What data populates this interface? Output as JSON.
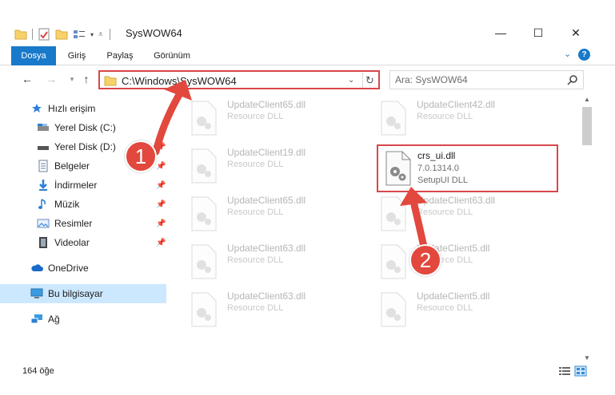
{
  "window": {
    "title": "SysWOW64",
    "minimize": "—",
    "maximize": "☐",
    "close": "✕"
  },
  "ribbon": {
    "tabs": [
      {
        "label": "Dosya",
        "active": true
      },
      {
        "label": "Giriş",
        "active": false
      },
      {
        "label": "Paylaş",
        "active": false
      },
      {
        "label": "Görünüm",
        "active": false
      }
    ]
  },
  "navbar": {
    "address": "C:\\Windows\\SysWOW64",
    "search_placeholder": "Ara: SysWOW64"
  },
  "sidebar": {
    "items": [
      {
        "label": "Hızlı erişim",
        "icon": "star-icon"
      },
      {
        "label": "Yerel Disk (C:)",
        "icon": "drive-icon"
      },
      {
        "label": "Yerel Disk (D:)",
        "icon": "drive-icon"
      },
      {
        "label": "Belgeler",
        "icon": "documents-icon"
      },
      {
        "label": "İndirmeler",
        "icon": "download-icon"
      },
      {
        "label": "Müzik",
        "icon": "music-icon"
      },
      {
        "label": "Resimler",
        "icon": "pictures-icon"
      },
      {
        "label": "Videolar",
        "icon": "video-icon"
      },
      {
        "label": "OneDrive",
        "icon": "cloud-icon"
      },
      {
        "label": "Bu bilgisayar",
        "icon": "computer-icon"
      },
      {
        "label": "Ağ",
        "icon": "network-icon"
      }
    ]
  },
  "files": {
    "left": [
      {
        "name": "UpdateClient65.dll",
        "desc": "Resource DLL"
      },
      {
        "name": "UpdateClient19.dll",
        "desc": "Resource DLL"
      },
      {
        "name": "UpdateClient65.dll",
        "desc": "Resource DLL"
      },
      {
        "name": "UpdateClient63.dll",
        "desc": "Resource DLL"
      },
      {
        "name": "UpdateClient63.dll",
        "desc": "Resource DLL"
      }
    ],
    "right": [
      {
        "name": "UpdateClient42.dll",
        "desc": "Resource DLL"
      },
      {
        "name": "UpdateClient63.dll",
        "desc": "Resource DLL"
      },
      {
        "name": "UpdateClient5.dll",
        "desc": "Resource DLL"
      },
      {
        "name": "UpdateClient5.dll",
        "desc": "Resource DLL"
      }
    ],
    "highlighted": {
      "name": "crs_ui.dll",
      "version": "7.0.1314.0",
      "desc": "SetupUI DLL"
    }
  },
  "status": {
    "count": "164 öğe"
  },
  "callouts": [
    "1",
    "2"
  ],
  "colors": {
    "accent": "#1979ca",
    "highlight": "#d9474a",
    "callout": "#e2483d",
    "selected": "#cce8ff"
  }
}
